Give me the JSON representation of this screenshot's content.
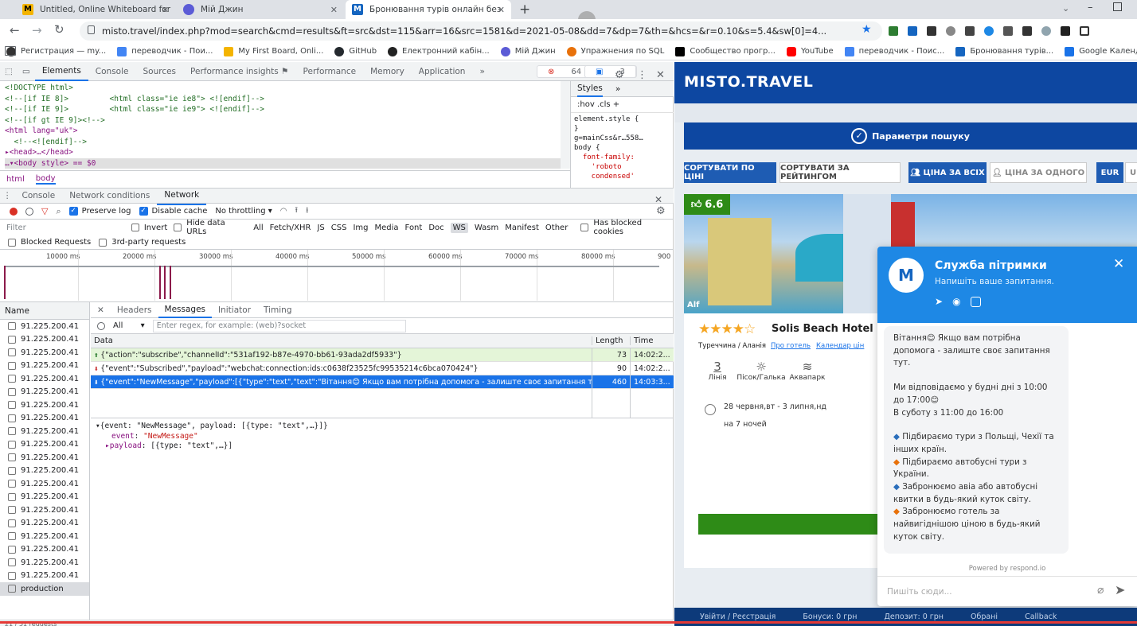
{
  "tabs": [
    {
      "title": "Untitled, Online Whiteboard for",
      "color": "#f4b400",
      "glyph": "M"
    },
    {
      "title": "Мій Джин",
      "color": "#5b5bd6",
      "glyph": "Д"
    },
    {
      "title": "Бронювання турів онлайн без",
      "color": "#1565c0",
      "glyph": "M"
    }
  ],
  "new_tab": "+",
  "url": "misto.travel/index.php?mod=search&cmd=results&ft=src&dst=115&arr=16&src=1581&d=2021-05-08&dd=7&dp=7&th=&hcs=&r=0.10&s=5.4&sw[0]=4...",
  "bookmarks": [
    {
      "label": "Регистрация — my...",
      "color": "#333"
    },
    {
      "label": "переводчик - Пои...",
      "color": "#4285f4"
    },
    {
      "label": "My First Board, Onli...",
      "color": "#f4b400"
    },
    {
      "label": "GitHub",
      "color": "#24292e"
    },
    {
      "label": "Електронний кабін...",
      "color": "#222"
    },
    {
      "label": "Мій Джин",
      "color": "#5b5bd6"
    },
    {
      "label": "Упражнения по SQL",
      "color": "#e8710a"
    },
    {
      "label": "Сообщество прогр...",
      "color": "#000"
    },
    {
      "label": "YouTube",
      "color": "#ff0000"
    },
    {
      "label": "переводчик - Поис...",
      "color": "#4285f4"
    },
    {
      "label": "Бронювання турів...",
      "color": "#1565c0"
    },
    {
      "label": "Google Календарь...",
      "color": "#1a73e8"
    }
  ],
  "devtools": {
    "tabs": [
      "Elements",
      "Console",
      "Sources",
      "Performance insights ⚑",
      "Performance",
      "Memory",
      "Application",
      "»"
    ],
    "errors": "64",
    "warnings": "8",
    "infos": "3",
    "dom_lines": [
      {
        "t": "<!DOCTYPE html>",
        "c": "cm"
      },
      {
        "t": "<!--[if IE 8]>         <html class=\"ie ie8\"> <![endif]-->",
        "c": "cm"
      },
      {
        "t": "<!--[if IE 9]>         <html class=\"ie ie9\"> <![endif]-->",
        "c": "cm"
      },
      {
        "t": "<!--[if gt IE 9]><!-->",
        "c": "cm"
      },
      {
        "t": "<html lang=\"uk\">",
        "c": "tg"
      },
      {
        "t": "  <!--<![endif]-->",
        "c": "cm"
      },
      {
        "t": "▸<head>…</head>",
        "c": "tg"
      },
      {
        "t": "…▾<body style> == $0",
        "c": "tg"
      }
    ],
    "crumbs": [
      "html",
      "body"
    ],
    "styles_tabs": [
      "Styles",
      "»"
    ],
    "styles_toolbar": ":hov  .cls  +",
    "styles_lines": [
      "element.style {",
      "}",
      "g=mainCss&r…558…",
      "body {",
      "  font-family:",
      "    'roboto",
      "    condensed'"
    ],
    "drawer_tabs": [
      "Console",
      "Network conditions",
      "Network"
    ],
    "net_toolbar": {
      "preserve": "Preserve log",
      "disable_cache": "Disable cache",
      "throttle": "No throttling"
    },
    "filter_placeholder": "Filter",
    "filter_types": [
      "Invert",
      "Hide data URLs",
      "All",
      "Fetch/XHR",
      "JS",
      "CSS",
      "Img",
      "Media",
      "Font",
      "Doc",
      "WS",
      "Wasm",
      "Manifest",
      "Other"
    ],
    "has_blocked": "Has blocked cookies",
    "blocked_requests": "Blocked Requests",
    "third_party": "3rd-party requests",
    "timeline_ticks": [
      "10000 ms",
      "20000 ms",
      "30000 ms",
      "40000 ms",
      "50000 ms",
      "60000 ms",
      "70000 ms",
      "80000 ms",
      "900"
    ],
    "name_header": "Name",
    "requests": [
      "91.225.200.41",
      "91.225.200.41",
      "91.225.200.41",
      "91.225.200.41",
      "91.225.200.41",
      "91.225.200.41",
      "91.225.200.41",
      "91.225.200.41",
      "91.225.200.41",
      "91.225.200.41",
      "91.225.200.41",
      "91.225.200.41",
      "91.225.200.41",
      "91.225.200.41",
      "91.225.200.41",
      "91.225.200.41",
      "91.225.200.41",
      "91.225.200.41",
      "91.225.200.41",
      "91.225.200.41",
      "production"
    ],
    "detail_tabs": [
      "Headers",
      "Messages",
      "Initiator",
      "Timing"
    ],
    "msg_filter_all": "All",
    "msg_filter_placeholder": "Enter regex, for example: (web)?socket",
    "msg_cols": [
      "Data",
      "Length",
      "Time"
    ],
    "messages": [
      {
        "data": "{\"action\":\"subscribe\",\"channelId\":\"531af192-b87e-4970-bb61-93ada2df5933\"}",
        "len": "73",
        "time": "14:02:2...",
        "kind": "sent"
      },
      {
        "data": "{\"event\":\"Subscribed\",\"payload\":\"webchat:connection:ids:c0638f23525fc99535214c6bca070424\"}",
        "len": "90",
        "time": "14:02:2...",
        "kind": "recv"
      },
      {
        "data": "{\"event\":\"NewMessage\",\"payload\":[{\"type\":\"text\",\"text\":\"Вітання😊 Якщо вам потрібна допомога - залиште своє запитання тут. \\...",
        "len": "460",
        "time": "14:03:3...",
        "kind": "sel"
      }
    ],
    "tree": {
      "root": "▾{event: \"NewMessage\", payload: [{type: \"text\",…}]}",
      "k1": "event",
      "v1": "\"NewMessage\"",
      "k2": "▸payload",
      "v2": "[{type: \"text\",…}]"
    },
    "status": "21 / 51 requests"
  },
  "site": {
    "logo": "MISTO.TRAVEL",
    "search_params": "Параметри пошуку",
    "sort_price": "СОРТУВАТИ ПО ЦІНІ",
    "sort_rating": "СОРТУВАТИ ЗА РЕЙТИНГОМ",
    "price_all": "ЦІНА ЗА ВСІХ",
    "price_one": "ЦІНА ЗА ОДНОГО",
    "currency": "EUR",
    "currency2": "U",
    "rating": "6.6",
    "img_label": "Alf",
    "hotel": "Solis Beach Hotel",
    "stars": 4,
    "location": "Туреччина / Аланія",
    "about": "Про готель",
    "calendar": "Календар цін",
    "features": [
      "Лінія",
      "Пісок/Галька",
      "Аквапарк"
    ],
    "line_no": "3",
    "dates": "28 червня,вт - 3 липня,нд",
    "nights": "на 7 ночей",
    "chat": {
      "title": "Служба пітримки",
      "subtitle": "Напишіть ваше запитання.",
      "msg1": "Вітання😊 Якщо вам потрібна допомога - залиште своє запитання тут.",
      "msg2": "Ми відповідаємо у будні дні з 10:00 до 17:00😊",
      "msg3": "В суботу з 11:00 до 16:00",
      "bullets": [
        {
          "t": "Підбираємо тури з Польщі, Чехії та інших країн.",
          "c": "#2a6ebb"
        },
        {
          "t": "Підбираємо автобусні тури з України.",
          "c": "#e8710a"
        },
        {
          "t": "Забронюємо авіа або автобусні квитки в будь-який куток світу.",
          "c": "#2a6ebb"
        },
        {
          "t": "Забронюємо готель за найвигіднішою ціною в будь-який куток світу.",
          "c": "#e8710a"
        }
      ],
      "powered": "Powered by respond.io",
      "input_placeholder": "Пишіть сюди..."
    },
    "footer": [
      "Увійти / Реєстрація",
      "Бонуси: 0 грн",
      "Депозит: 0 грн",
      "Обрані",
      "Callback"
    ]
  },
  "colors": {
    "accent": "#1a73e8",
    "brand": "#0d47a1",
    "green": "#2e8b17",
    "chat_blue": "#1e88e5"
  }
}
